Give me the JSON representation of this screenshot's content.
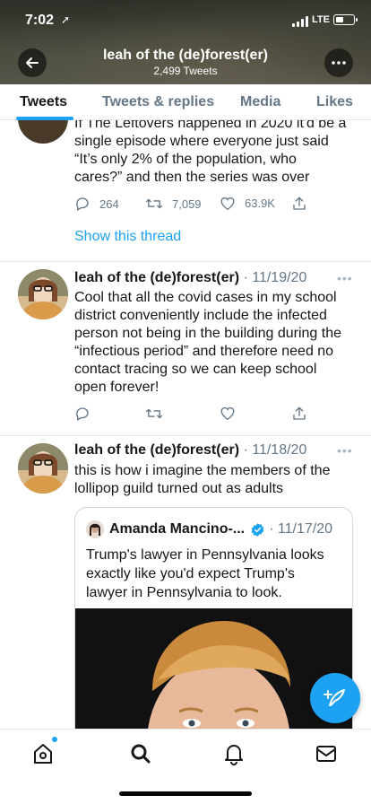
{
  "status": {
    "time": "7:02",
    "network": "LTE"
  },
  "profile": {
    "name": "leah of the (de)forest(er)",
    "tweets_count": "2,499 Tweets"
  },
  "tabs": [
    {
      "label": "Tweets",
      "active": true
    },
    {
      "label": "Tweets & replies",
      "active": false
    },
    {
      "label": "Media",
      "active": false
    },
    {
      "label": "Likes",
      "active": false
    }
  ],
  "tweets": [
    {
      "text_lines": [
        "If The Leftovers happened in 2020 it'd be a",
        "single episode where everyone just said",
        "“It’s only 2% of the population, who",
        "cares?” and then the series was over"
      ],
      "replies": "264",
      "retweets": "7,059",
      "likes": "63.9K",
      "show_thread": "Show this thread"
    },
    {
      "name": "leah of the (de)forest(er)",
      "date": "· 11/19/20",
      "text_lines": [
        "Cool that all the covid cases in my school",
        "district conveniently include the infected",
        "person not being in the building during the",
        "“infectious period” and therefore need no",
        "contact tracing so we can keep school",
        "open forever!"
      ]
    },
    {
      "name": "leah of the (de)forest(er)",
      "date": "· 11/18/20",
      "text_lines": [
        "this is how i imagine the members of the",
        "lollipop guild turned out as adults"
      ],
      "quote": {
        "name": "Amanda Mancino-...",
        "date": "· 11/17/20",
        "text_lines": [
          "Trump's lawyer in Pennsylvania looks",
          "exactly like you'd expect Trump's",
          "lawyer in Pennsylvania to look."
        ]
      }
    }
  ],
  "colors": {
    "accent": "#1da1f2",
    "text": "#14171a",
    "muted": "#657786",
    "border": "#e1e8ed"
  },
  "icons": [
    "back-arrow-icon",
    "more-icon",
    "reply-icon",
    "retweet-icon",
    "like-icon",
    "share-icon",
    "verified-icon",
    "compose-icon",
    "home-icon",
    "search-icon",
    "notifications-icon",
    "messages-icon"
  ]
}
